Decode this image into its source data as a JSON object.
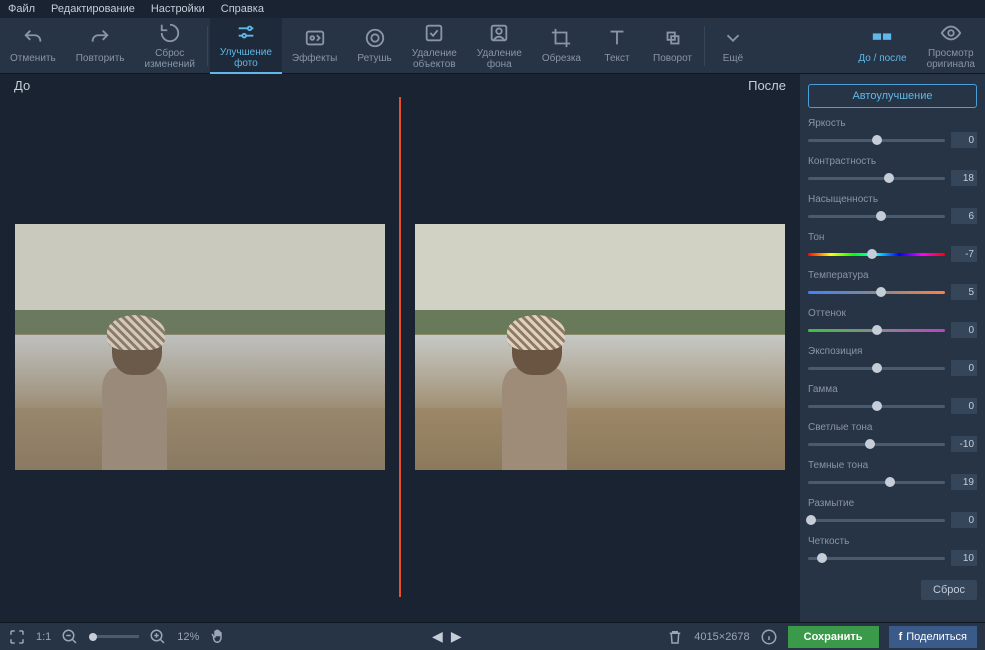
{
  "menubar": [
    "Файл",
    "Редактирование",
    "Настройки",
    "Справка"
  ],
  "toolbar": {
    "undo": "Отменить",
    "redo": "Повторить",
    "reset": "Сброс\nизменений",
    "enhance": "Улучшение\nфото",
    "effects": "Эффекты",
    "retouch": "Ретушь",
    "removeObj": "Удаление\nобъектов",
    "removeBg": "Удаление\nфона",
    "crop": "Обрезка",
    "text": "Текст",
    "rotate": "Поворот",
    "more": "Ещё",
    "beforeAfter": "До / после",
    "original": "Просмотр\nоригинала"
  },
  "compare": {
    "before": "До",
    "after": "После"
  },
  "sidebar": {
    "auto": "Автоулучшение",
    "sliders": [
      {
        "label": "Яркость",
        "value": 0,
        "pos": 50,
        "type": "plain"
      },
      {
        "label": "Контрастность",
        "value": 18,
        "pos": 59,
        "type": "plain"
      },
      {
        "label": "Насыщенность",
        "value": 6,
        "pos": 53,
        "type": "plain"
      },
      {
        "label": "Тон",
        "value": -7,
        "pos": 47,
        "type": "hue"
      },
      {
        "label": "Температура",
        "value": 5,
        "pos": 53,
        "type": "temp"
      },
      {
        "label": "Оттенок",
        "value": 0,
        "pos": 50,
        "type": "tint"
      },
      {
        "label": "Экспозиция",
        "value": 0,
        "pos": 50,
        "type": "plain"
      },
      {
        "label": "Гамма",
        "value": 0,
        "pos": 50,
        "type": "plain"
      },
      {
        "label": "Светлые тона",
        "value": -10,
        "pos": 45,
        "type": "plain"
      },
      {
        "label": "Темные тона",
        "value": 19,
        "pos": 60,
        "type": "plain"
      },
      {
        "label": "Размытие",
        "value": 0,
        "pos": 2,
        "type": "plain"
      },
      {
        "label": "Четкость",
        "value": 10,
        "pos": 10,
        "type": "plain"
      }
    ],
    "reset": "Сброс"
  },
  "statusbar": {
    "fit": "1:1",
    "zoom": "12%",
    "dimensions": "4015×2678",
    "save": "Сохранить",
    "share": "Поделиться"
  }
}
